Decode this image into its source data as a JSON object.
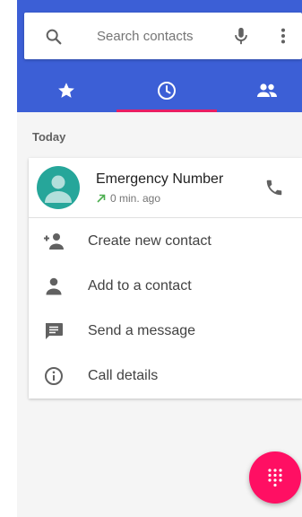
{
  "search": {
    "placeholder": "Search contacts",
    "icon": "search-icon",
    "mic_icon": "mic-icon",
    "more_icon": "more-vert-icon"
  },
  "tabs": [
    {
      "id": "favorites",
      "icon": "star-icon",
      "selected": false
    },
    {
      "id": "recents",
      "icon": "clock-icon",
      "selected": true
    },
    {
      "id": "contacts",
      "icon": "people-icon",
      "selected": false
    }
  ],
  "recents": {
    "section_label": "Today",
    "entry": {
      "name": "Emergency Number",
      "time": "0 min. ago",
      "call_type_icon": "outgoing-call-arrow-icon",
      "action_icon": "phone-icon"
    },
    "actions": [
      {
        "label": "Create new contact",
        "icon": "person-add-icon"
      },
      {
        "label": "Add to a contact",
        "icon": "person-icon"
      },
      {
        "label": "Send a message",
        "icon": "message-icon"
      },
      {
        "label": "Call details",
        "icon": "info-icon"
      }
    ]
  },
  "fab": {
    "icon": "dialpad-icon"
  },
  "colors": {
    "primary": "#3c5fd6",
    "accent": "#e91e63",
    "fab": "#ff0f63",
    "avatar": "#26a69a",
    "outgoing_arrow": "#4caf50"
  }
}
